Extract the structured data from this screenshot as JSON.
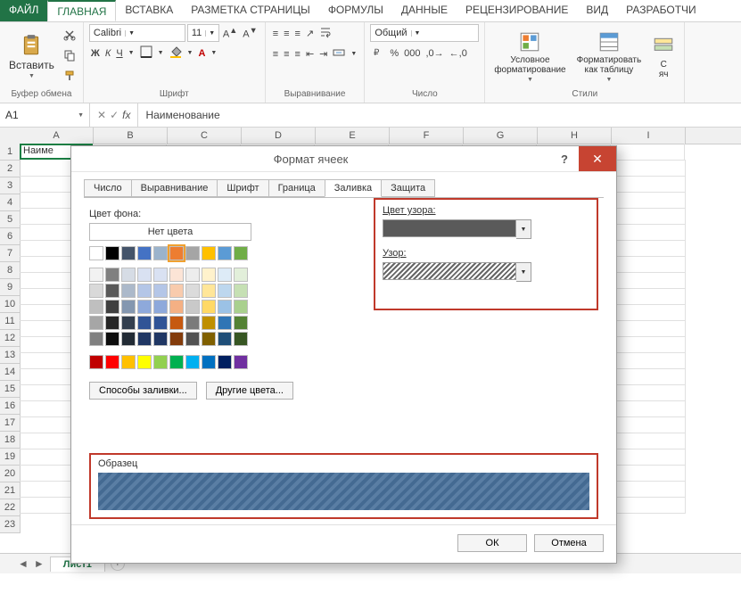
{
  "ribbon": {
    "tabs": {
      "file": "ФАЙЛ",
      "home": "ГЛАВНАЯ",
      "insert": "ВСТАВКА",
      "layout": "РАЗМЕТКА СТРАНИЦЫ",
      "formulas": "ФОРМУЛЫ",
      "data": "ДАННЫЕ",
      "review": "РЕЦЕНЗИРОВАНИЕ",
      "view": "ВИД",
      "developer": "РАЗРАБОТЧИ"
    },
    "groups": {
      "clipboard": "Буфер обмена",
      "font": "Шрифт",
      "alignment": "Выравнивание",
      "number": "Число",
      "styles": "Стили"
    },
    "paste": "Вставить",
    "font_name": "Calibri",
    "font_size": "11",
    "number_format": "Общий",
    "cond_format": "Условное\nформатирование",
    "as_table": "Форматировать\nкак таблицу",
    "cell_styles": "С\nяч",
    "bold": "Ж",
    "italic": "К",
    "underline": "Ч"
  },
  "formula_bar": {
    "cell_ref": "A1",
    "value": "Наименование"
  },
  "sheet": {
    "cell_a1": "Наиме",
    "tab": "Лист1",
    "nav_left": "◄",
    "nav_right": "►"
  },
  "columns": [
    "A",
    "B",
    "C",
    "D",
    "E",
    "F",
    "G",
    "H",
    "I"
  ],
  "rows": [
    "1",
    "2",
    "3",
    "4",
    "5",
    "6",
    "7",
    "8",
    "9",
    "10",
    "11",
    "12",
    "13",
    "14",
    "15",
    "16",
    "17",
    "18",
    "19",
    "20",
    "21",
    "22",
    "23"
  ],
  "dialog": {
    "title": "Формат ячеек",
    "tabs": {
      "number": "Число",
      "alignment": "Выравнивание",
      "font": "Шрифт",
      "border": "Граница",
      "fill": "Заливка",
      "protection": "Защита"
    },
    "fill": {
      "bg_label": "Цвет фона:",
      "no_color": "Нет цвета",
      "pattern_color_label": "Цвет узора:",
      "pattern_label": "Узор:",
      "fill_effects": "Способы заливки...",
      "more_colors": "Другие цвета...",
      "sample": "Образец"
    },
    "ok": "ОК",
    "cancel": "Отмена"
  },
  "colors": {
    "theme_row1": [
      "#ffffff",
      "#000000",
      "#44546a",
      "#4472c4",
      "#ed7d31",
      "#a5a5a5",
      "#ffc000",
      "#5b9bd5",
      "#70ad47"
    ],
    "theme_block": [
      [
        "#f2f2f2",
        "#808080",
        "#d6dce5",
        "#d9e1f2",
        "#fce4d6",
        "#ededed",
        "#fff2cc",
        "#ddebf7",
        "#e2efda"
      ],
      [
        "#d9d9d9",
        "#595959",
        "#acb9ca",
        "#b4c6e7",
        "#f8cbad",
        "#dbdbdb",
        "#ffe699",
        "#bdd7ee",
        "#c6e0b4"
      ],
      [
        "#bfbfbf",
        "#404040",
        "#8497b0",
        "#8ea9db",
        "#f4b084",
        "#c9c9c9",
        "#ffd966",
        "#9bc2e6",
        "#a9d08e"
      ],
      [
        "#a6a6a6",
        "#262626",
        "#333f4f",
        "#305496",
        "#c65911",
        "#7b7b7b",
        "#bf8f00",
        "#2f75b5",
        "#548235"
      ],
      [
        "#808080",
        "#0d0d0d",
        "#222b35",
        "#203764",
        "#833c0c",
        "#525252",
        "#806000",
        "#1f4e78",
        "#375623"
      ]
    ],
    "standard": [
      "#c00000",
      "#ff0000",
      "#ffc000",
      "#ffff00",
      "#92d050",
      "#00b050",
      "#00b0f0",
      "#0070c0",
      "#002060",
      "#7030a0"
    ]
  }
}
